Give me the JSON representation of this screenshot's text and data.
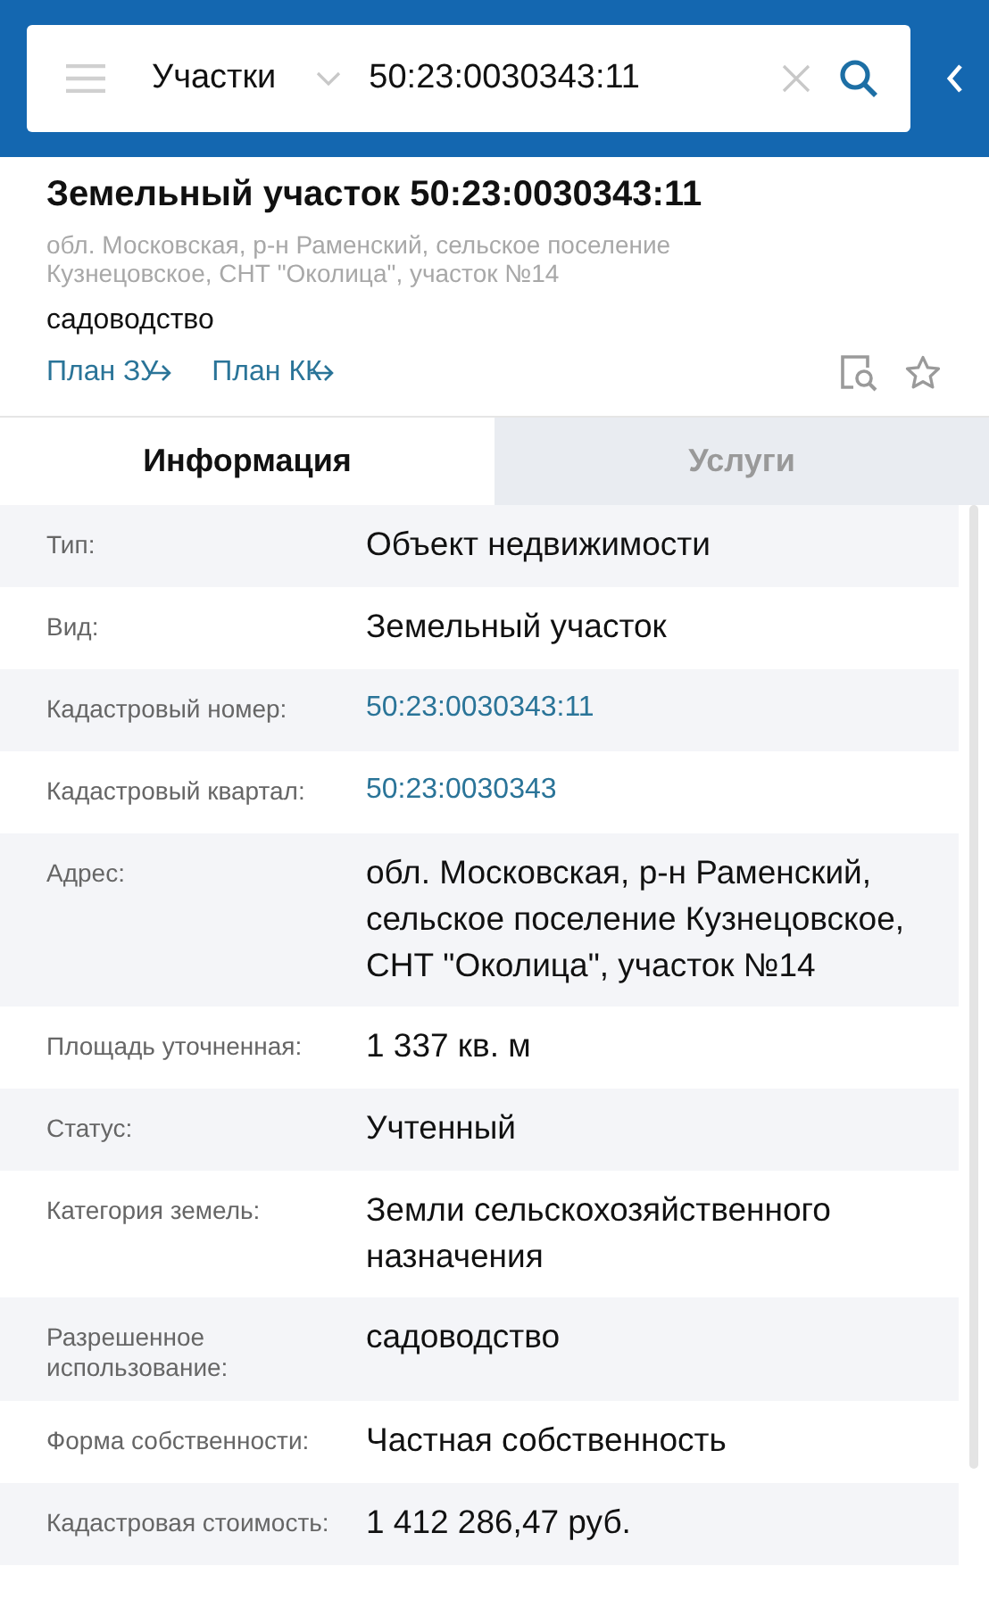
{
  "search_bar": {
    "category": "Участки",
    "query": "50:23:0030343:11"
  },
  "object": {
    "title": "Земельный участок 50:23:0030343:11",
    "address": "обл. Московская, р-н Раменский, сельское поселение Кузнецовское, СНТ \"Околица\", участок №14",
    "usage": "садоводство",
    "links": [
      "План ЗУ",
      "План КК"
    ]
  },
  "tabs": [
    {
      "label": "Информация",
      "selected": true
    },
    {
      "label": "Услуги",
      "selected": false
    }
  ],
  "rows": [
    {
      "label": "Тип:",
      "value": "Объект недвижимости",
      "kind": "text"
    },
    {
      "label": "Вид:",
      "value": "Земельный участок",
      "kind": "text"
    },
    {
      "label": "Кадастровый номер:",
      "value": "50:23:0030343:11",
      "kind": "link"
    },
    {
      "label": "Кадастровый квартал:",
      "value": "50:23:0030343",
      "kind": "link"
    },
    {
      "label": "Адрес:",
      "value": "обл. Московская, р-н Раменский, сельское поселение Кузнецовское, СНТ \"Околица\", участок №14",
      "kind": "text"
    },
    {
      "label": "Площадь уточненная:",
      "value": "1 337 кв. м",
      "kind": "text"
    },
    {
      "label": "Статус:",
      "value": "Учтенный",
      "kind": "text"
    },
    {
      "label": "Категория земель:",
      "value": "Земли сельскохозяйственного назначения",
      "kind": "text"
    },
    {
      "label": "Разрешенное использование:",
      "value": "садоводство",
      "kind": "text"
    },
    {
      "label": "Форма собственности:",
      "value": "Частная собственность",
      "kind": "text"
    },
    {
      "label": "Кадастровая стоимость:",
      "value": "1 412 286,47 руб.",
      "kind": "text"
    }
  ]
}
